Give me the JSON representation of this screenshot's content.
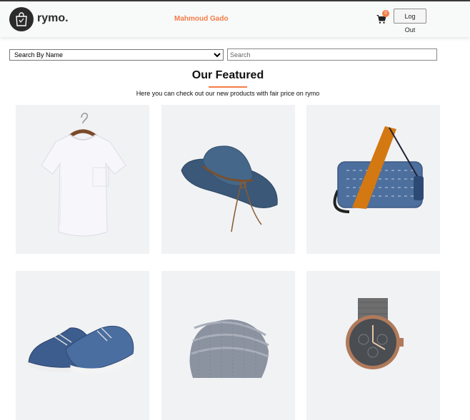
{
  "brand": {
    "name": "rymo.",
    "logo_icon": "shopping-bag-icon"
  },
  "header": {
    "username": "Mahmoud Gado",
    "cart_icon": "shopping-cart-icon",
    "cart_count": "0",
    "logout_label": "Log Out"
  },
  "search": {
    "filter_selected": "Search By Name",
    "placeholder": "Search"
  },
  "featured": {
    "title": "Our Featured",
    "subtitle": "Here you can check out our new products with fair price on rymo"
  },
  "products": [
    {
      "image": "white-tshirt-on-hanger"
    },
    {
      "image": "denim-cowboy-hat"
    },
    {
      "image": "denim-crossbody-bag"
    },
    {
      "image": "blue-sneakers"
    },
    {
      "image": "grey-beanie"
    },
    {
      "image": "grey-strap-watch"
    }
  ],
  "colors": {
    "accent": "#f47c48",
    "card_bg": "#f1f2f4",
    "dark": "#2b2b2b"
  }
}
